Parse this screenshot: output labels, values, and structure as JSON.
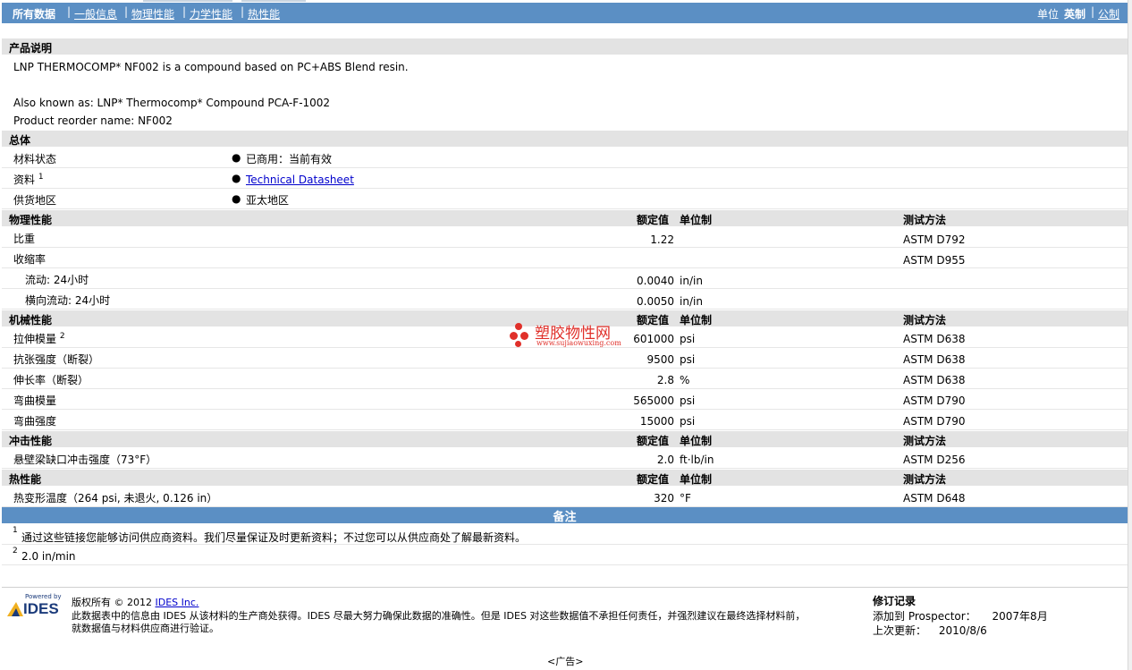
{
  "nav": {
    "items": [
      "所有数据",
      "一般信息",
      "物理性能",
      "力学性能",
      "热性能"
    ],
    "unit_label": "单位",
    "unit_english": "英制",
    "unit_metric": "公制"
  },
  "description": {
    "title": "产品说明",
    "line1": "LNP THERMOCOMP* NF002 is a compound based on PC+ABS Blend resin.",
    "line2": "Also known as: LNP* Thermocomp* Compound PCA-F-1002",
    "line3": "Product reorder name: NF002"
  },
  "general": {
    "title": "总体",
    "rows": [
      {
        "label": "材料状态",
        "sup": "",
        "value": "已商用：当前有效"
      },
      {
        "label": "资料",
        "sup": "1",
        "value": "Technical Datasheet"
      },
      {
        "label": "供货地区",
        "sup": "",
        "value": "亚太地区"
      }
    ]
  },
  "headers": {
    "nominal": "额定值",
    "unit": "单位制",
    "method": "测试方法"
  },
  "physical": {
    "title": "物理性能",
    "rows": [
      {
        "label": "比重",
        "sup": "",
        "value": "1.22",
        "unit": "",
        "method": "ASTM D792"
      },
      {
        "label": "收缩率",
        "sup": "",
        "value": "",
        "unit": "",
        "method": "ASTM D955"
      },
      {
        "label": "流动: 24小时",
        "sup": "",
        "value": "0.0040",
        "unit": "in/in",
        "method": ""
      },
      {
        "label": "横向流动: 24小时",
        "sup": "",
        "value": "0.0050",
        "unit": "in/in",
        "method": ""
      }
    ]
  },
  "mechanical": {
    "title": "机械性能",
    "rows": [
      {
        "label": "拉伸模量",
        "sup": "2",
        "value": "601000",
        "unit": "psi",
        "method": "ASTM D638"
      },
      {
        "label": "抗张强度（断裂）",
        "sup": "",
        "value": "9500",
        "unit": "psi",
        "method": "ASTM D638"
      },
      {
        "label": "伸长率（断裂）",
        "sup": "",
        "value": "2.8",
        "unit": "%",
        "method": "ASTM D638"
      },
      {
        "label": "弯曲模量",
        "sup": "",
        "value": "565000",
        "unit": "psi",
        "method": "ASTM D790"
      },
      {
        "label": "弯曲强度",
        "sup": "",
        "value": "15000",
        "unit": "psi",
        "method": "ASTM D790"
      }
    ]
  },
  "impact": {
    "title": "冲击性能",
    "rows": [
      {
        "label": "悬壁梁缺口冲击强度（73°F）",
        "sup": "",
        "value": "2.0",
        "unit": "ft·lb/in",
        "method": "ASTM D256"
      }
    ]
  },
  "thermal": {
    "title": "热性能",
    "rows": [
      {
        "label": "热变形温度（264 psi, 未退火, 0.126 in）",
        "sup": "",
        "value": "320",
        "unit": "°F",
        "method": "ASTM D648"
      }
    ]
  },
  "notes": {
    "title": "备注",
    "items": [
      {
        "num": "1",
        "text": "通过这些链接您能够访问供应商资料。我们尽量保证及时更新资料；不过您可以从供应商处了解最新资料。"
      },
      {
        "num": "2",
        "text": "2.0 in/min"
      }
    ]
  },
  "watermark": {
    "title": "塑胶物性网",
    "url": "www.sujiaowuxing.com"
  },
  "footer": {
    "logo_small": "Powered by",
    "logo_text": "IDES",
    "copyright_prefix": "版权所有 © 2012",
    "copyright_link": "IDES Inc.",
    "disclaimer1": "此数据表中的信息由 IDES 从该材料的生产商处获得。IDES 尽最大努力确保此数据的准确性。但是 IDES 对这些数据值不承担任何责任，并强烈建议在最终选择材料前，",
    "disclaimer2": "就数据值与材料供应商进行验证。",
    "revision_title": "修订记录",
    "added_label": "添加到 Prospector：",
    "added_value": "2007年8月",
    "updated_label": "上次更新：",
    "updated_value": "2010/8/6",
    "ad": "<广告>"
  }
}
